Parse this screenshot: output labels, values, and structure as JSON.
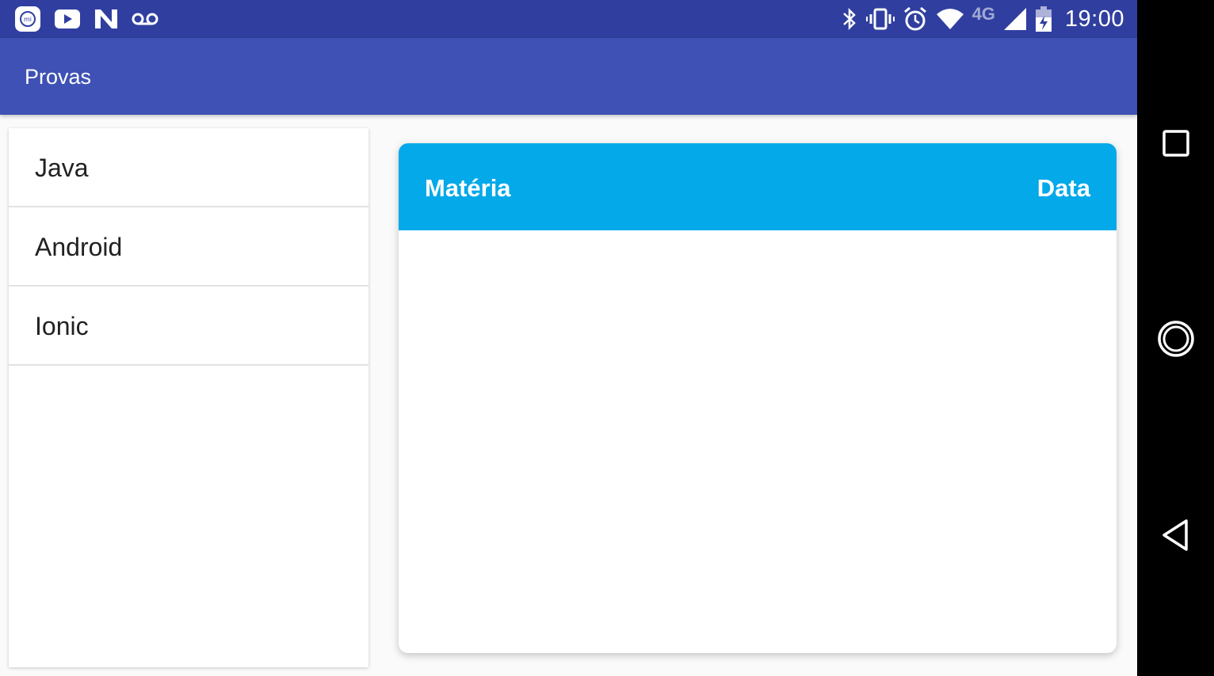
{
  "status_bar": {
    "time": "19:00",
    "network_label": "4G",
    "left_icons": [
      "mi-icon",
      "youtube-icon",
      "n-icon",
      "voicemail-icon"
    ],
    "right_icons": [
      "bluetooth-icon",
      "vibrate-icon",
      "alarm-icon",
      "wifi-icon",
      "signal-icon",
      "battery-icon"
    ],
    "background": "#303f9f"
  },
  "app_bar": {
    "title": "Provas",
    "background": "#3f51b5"
  },
  "list": {
    "items": [
      {
        "label": "Java"
      },
      {
        "label": "Android"
      },
      {
        "label": "Ionic"
      }
    ]
  },
  "table": {
    "header_color": "#03a9e9",
    "columns": [
      "Matéria",
      "Data"
    ],
    "rows": []
  },
  "nav_bar": {
    "buttons": [
      "recents-icon",
      "home-icon",
      "back-icon"
    ]
  }
}
